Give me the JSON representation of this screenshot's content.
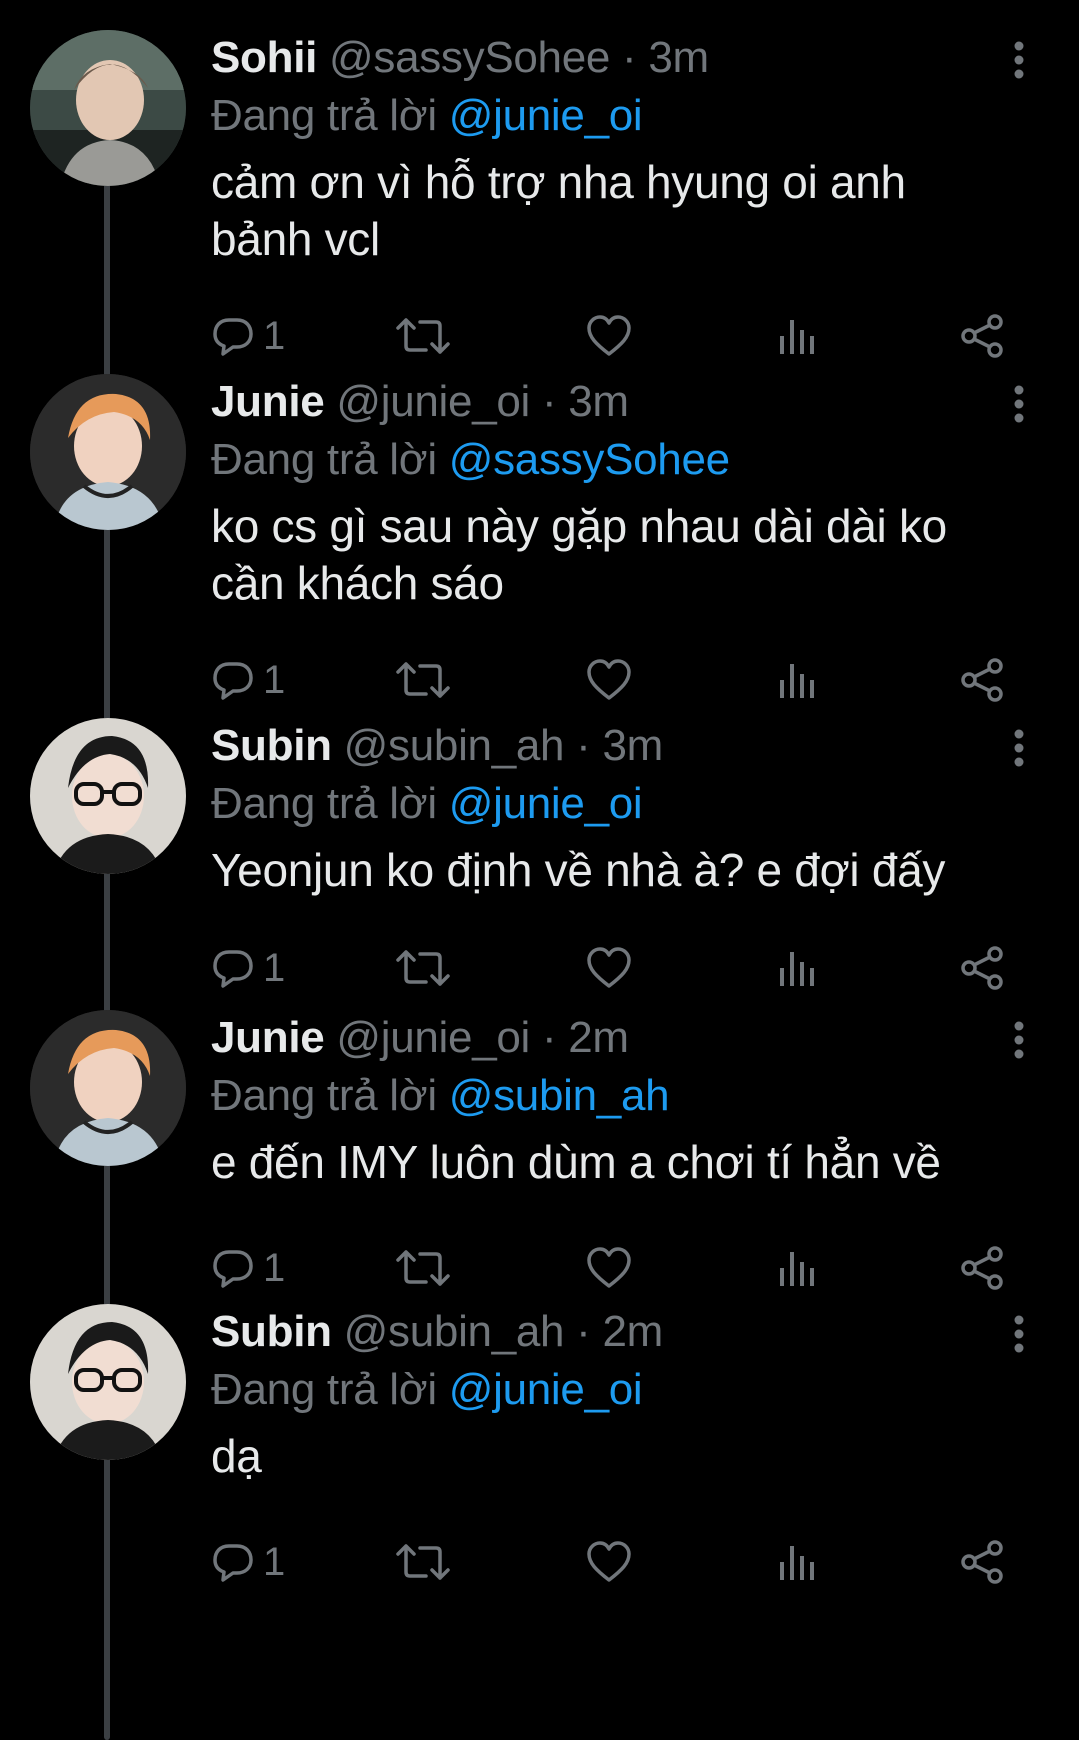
{
  "colors": {
    "background": "#000000",
    "text": "#e7e9ea",
    "secondary": "#71767b",
    "mention": "#1d9bf0",
    "thread_line": "#3b3f43"
  },
  "tweets": [
    {
      "display_name": "Sohii",
      "handle": "@sassySohee",
      "separator": "·",
      "time": "3m",
      "reply_prefix": "Đang trả lời",
      "reply_to": "@junie_oi",
      "text": "cảm ơn vì hỗ trợ nha hyung oi anh bảnh vcl",
      "reply_count": "1",
      "avatar_icon": "profile-photo"
    },
    {
      "display_name": "Junie",
      "handle": "@junie_oi",
      "separator": "·",
      "time": "3m",
      "reply_prefix": "Đang trả lời",
      "reply_to": "@sassySohee",
      "text": "ko cs gì sau này gặp nhau dài dài ko cần khách sáo",
      "reply_count": "1",
      "avatar_icon": "profile-photo"
    },
    {
      "display_name": "Subin",
      "handle": "@subin_ah",
      "separator": "·",
      "time": "3m",
      "reply_prefix": "Đang trả lời",
      "reply_to": "@junie_oi",
      "text": "Yeonjun ko định về nhà à? e đợi đấy",
      "reply_count": "1",
      "avatar_icon": "profile-photo"
    },
    {
      "display_name": "Junie",
      "handle": "@junie_oi",
      "separator": "·",
      "time": "2m",
      "reply_prefix": "Đang trả lời",
      "reply_to": "@subin_ah",
      "text": "e đến IMY luôn dùm a chơi tí hẳn về",
      "reply_count": "1",
      "avatar_icon": "profile-photo"
    },
    {
      "display_name": "Subin",
      "handle": "@subin_ah",
      "separator": "·",
      "time": "2m",
      "reply_prefix": "Đang trả lời",
      "reply_to": "@junie_oi",
      "text": "dạ",
      "reply_count": "1",
      "avatar_icon": "profile-photo"
    }
  ]
}
